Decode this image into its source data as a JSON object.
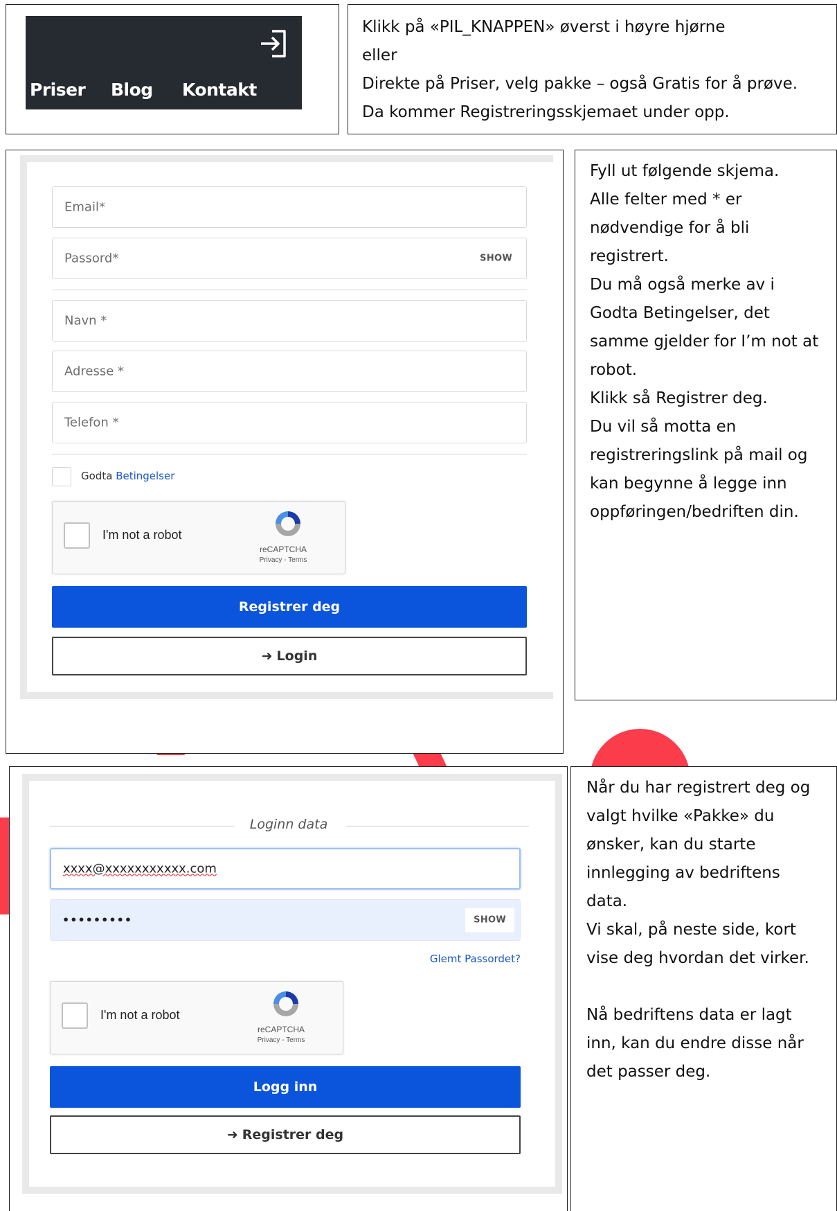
{
  "section1": {
    "nav": {
      "items": [
        "Priser",
        "Blog",
        "Kontakt"
      ],
      "login_icon": "login-arrow-icon"
    },
    "instructions": [
      "Klikk på «PIL_KNAPPEN» øverst i høyre hjørne",
      "eller",
      "Direkte på Priser, velg pakke – også Gratis for å prøve.",
      "Da kommer Registreringsskjemaet under opp."
    ]
  },
  "section2": {
    "form": {
      "email_placeholder": "Email*",
      "password_placeholder": "Passord*",
      "show_label": "SHOW",
      "name_placeholder": "Navn *",
      "address_placeholder": "Adresse *",
      "phone_placeholder": "Telefon *",
      "terms_prefix": "Godta",
      "terms_link": "Betingelser",
      "recaptcha_label": "I'm not a robot",
      "recaptcha_brand": "reCAPTCHA",
      "recaptcha_links": "Privacy - Terms",
      "register_button": "Registrer deg",
      "login_button": "Login"
    },
    "instructions": [
      "Fyll ut følgende skjema.",
      "Alle felter med * er",
      "nødvendige for å bli",
      "registrert.",
      "Du må også merke av i",
      "Godta Betingelser, det",
      "samme gjelder for I’m not at",
      "robot.",
      "Klikk så Registrer deg.",
      "Du vil så motta en",
      "registreringslink på mail og",
      "kan begynne å legge inn",
      "oppføringen/bedriften din."
    ]
  },
  "section3": {
    "form": {
      "legend": "Loginn data",
      "email_value": "xxxx@xxxxxxxxxxx.com",
      "password_value": "•••••••••",
      "show_label": "SHOW",
      "forgot_link": "Glemt Passordet?",
      "recaptcha_label": "I'm not a robot",
      "recaptcha_brand": "reCAPTCHA",
      "recaptcha_links": "Privacy - Terms",
      "login_button": "Logg inn",
      "register_button": "Registrer deg"
    },
    "instructions": [
      "Når du har registrert deg og",
      "valgt hvilke «Pakke» du",
      "ønsker, kan du starte",
      "innlegging av bedriftens",
      "data.",
      "Vi skal, på neste side, kort",
      "vise deg hvordan det virker.",
      "",
      "Nå bedriftens data er lagt",
      "inn, kan du endre disse når",
      "det passer deg."
    ]
  },
  "colors": {
    "primary_button": "#0b54dc",
    "nav_background": "#262a31",
    "link": "#1a56c8",
    "decor_red": "#fb3c4a"
  }
}
